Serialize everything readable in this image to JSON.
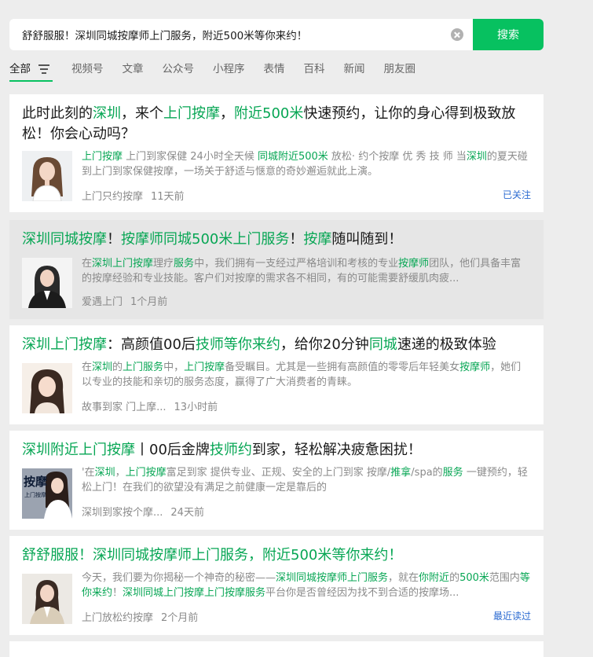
{
  "search": {
    "query": "舒舒服服！深圳同城按摩师上门服务，附近500米等你来约！",
    "button_label": "搜索"
  },
  "tabs": [
    {
      "label": "全部"
    },
    {
      "label": "视频号"
    },
    {
      "label": "文章"
    },
    {
      "label": "公众号"
    },
    {
      "label": "小程序"
    },
    {
      "label": "表情"
    },
    {
      "label": "百科"
    },
    {
      "label": "新闻"
    },
    {
      "label": "朋友圈"
    }
  ],
  "results": [
    {
      "title": [
        {
          "t": "此时此刻的"
        },
        {
          "t": "深圳",
          "h": true
        },
        {
          "t": "，来个"
        },
        {
          "t": "上门按摩",
          "h": true
        },
        {
          "t": "，"
        },
        {
          "t": "附近500米",
          "h": true
        },
        {
          "t": "快速预约，让你的身心得到极致放松！你会心动吗？"
        }
      ],
      "desc": [
        {
          "t": "上门按摩",
          "h": true
        },
        {
          "t": " 上门到家保健 24小时全天候 "
        },
        {
          "t": "同城附近500米",
          "h": true
        },
        {
          "t": " 放松· 约个按摩 优 秀 技 师 当"
        },
        {
          "t": "深圳",
          "h": true
        },
        {
          "t": "的夏天碰到上门到家保健按摩，一场关于舒适与惬意的奇妙邂逅就此上演。"
        }
      ],
      "source": "上门只约按摩",
      "time": "11天前",
      "tag": "已关注"
    },
    {
      "title": [
        {
          "t": "深圳同城按摩",
          "h": true
        },
        {
          "t": "！"
        },
        {
          "t": "按摩师同城500米上门服务",
          "h": true
        },
        {
          "t": "！"
        },
        {
          "t": "按摩",
          "h": true
        },
        {
          "t": "随叫随到！"
        }
      ],
      "desc": [
        {
          "t": "在"
        },
        {
          "t": "深圳上门按摩",
          "h": true
        },
        {
          "t": "理疗"
        },
        {
          "t": "服务",
          "h": true
        },
        {
          "t": "中，我们拥有一支经过严格培训和考核的专业"
        },
        {
          "t": "按摩师",
          "h": true
        },
        {
          "t": "团队，他们具备丰富的按摩经验和专业技能。客户们对按摩的需求各不相同，有的可能需要舒缓肌肉疲..."
        }
      ],
      "source": "爱遇上门",
      "time": "1个月前",
      "tag": ""
    },
    {
      "title": [
        {
          "t": "深圳上门按摩",
          "h": true
        },
        {
          "t": "：高颜值00后"
        },
        {
          "t": "技师等你来约",
          "h": true
        },
        {
          "t": "，给你20分钟"
        },
        {
          "t": "同城",
          "h": true
        },
        {
          "t": "速递的极致体验"
        }
      ],
      "desc": [
        {
          "t": "在"
        },
        {
          "t": "深圳",
          "h": true
        },
        {
          "t": "的"
        },
        {
          "t": "上门服务",
          "h": true
        },
        {
          "t": "中，"
        },
        {
          "t": "上门按摩",
          "h": true
        },
        {
          "t": "备受瞩目。尤其是一些拥有高颜值的零零后年轻美女"
        },
        {
          "t": "按摩师",
          "h": true
        },
        {
          "t": "，她们以专业的技能和亲切的服务态度，赢得了广大消费者的青睐。"
        }
      ],
      "source": "故事到家 门上摩...",
      "time": "13小时前",
      "tag": ""
    },
    {
      "title": [
        {
          "t": "深圳附近上门按摩",
          "h": true
        },
        {
          "t": "丨00后金牌"
        },
        {
          "t": "技师约",
          "h": true
        },
        {
          "t": "到家，轻松解决疲惫困扰！"
        }
      ],
      "desc": [
        {
          "t": "'在"
        },
        {
          "t": "深圳",
          "h": true
        },
        {
          "t": "，"
        },
        {
          "t": "上门按摩",
          "h": true
        },
        {
          "t": "富足到家 提供专业、正规、安全的上门到家 按摩/"
        },
        {
          "t": "推拿",
          "h": true
        },
        {
          "t": "/spa的"
        },
        {
          "t": "服务",
          "h": true
        },
        {
          "t": " 一键预约，轻松上门！在我们的欲望没有满足之前健康一定是靠后的"
        }
      ],
      "source": "深圳到家按个摩...",
      "time": "24天前",
      "tag": ""
    },
    {
      "title": [
        {
          "t": "舒舒服服！深圳同城按摩师上门服务，附近500米等你来约！",
          "h": true
        }
      ],
      "desc": [
        {
          "t": "今天，我们要为你揭秘一个神奇的秘密——"
        },
        {
          "t": "深圳同城按摩师上门服务",
          "h": true
        },
        {
          "t": "，就在"
        },
        {
          "t": "你附近",
          "h": true
        },
        {
          "t": "的"
        },
        {
          "t": "500米",
          "h": true
        },
        {
          "t": "范围内"
        },
        {
          "t": "等你来约",
          "h": true
        },
        {
          "t": "！"
        },
        {
          "t": "深圳同城上门按摩上门按摩服务",
          "h": true
        },
        {
          "t": "平台你是否曾经因为找不到合适的按摩场..."
        }
      ],
      "source": "上门放松约按摩",
      "time": "2个月前",
      "tag": "最近读过"
    }
  ],
  "thumb_thumb4_text": [
    "按摩",
    "上门按摩"
  ]
}
